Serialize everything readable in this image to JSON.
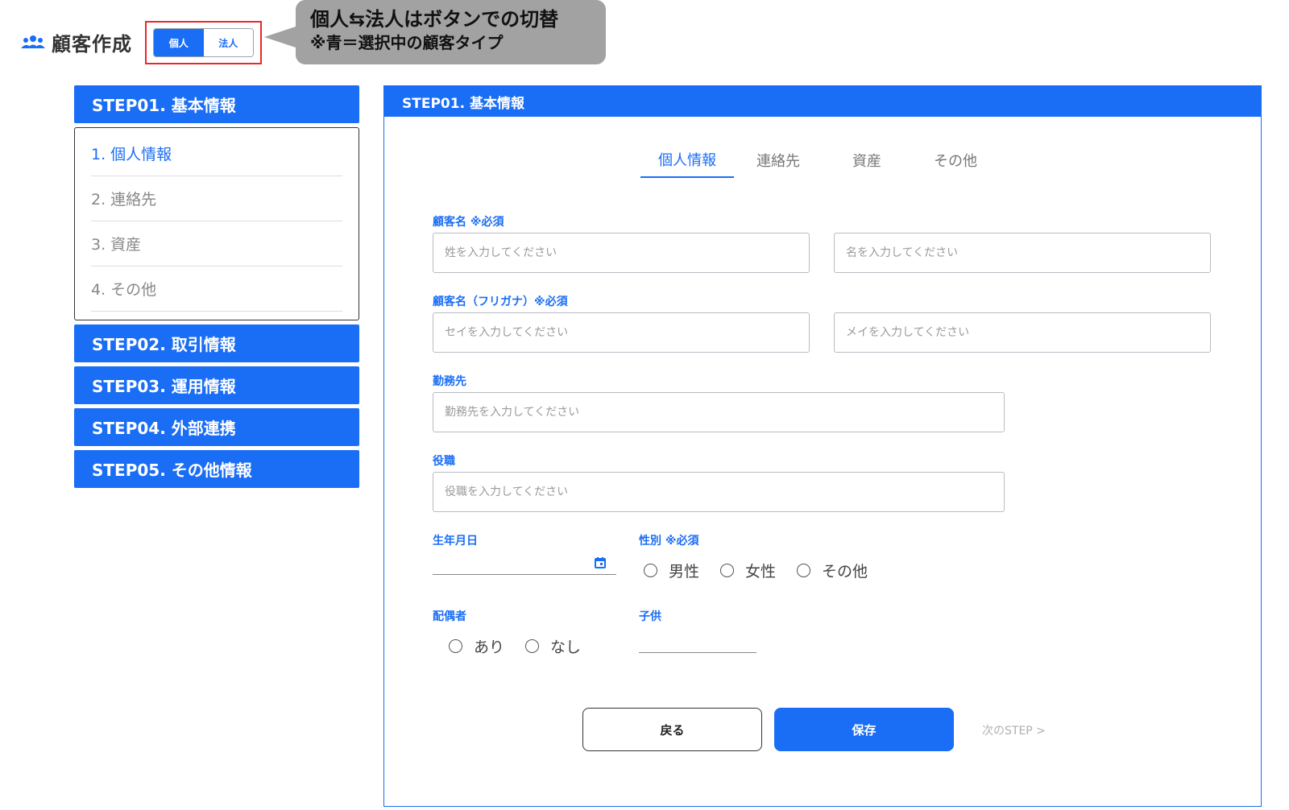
{
  "header": {
    "title": "顧客作成",
    "icon": "people-icon"
  },
  "customer_type_toggle": {
    "individual_label": "個人",
    "corporate_label": "法人",
    "selected": "個人"
  },
  "callout": {
    "line1": "個人⇆法人はボタンでの切替",
    "line2": "※青＝選択中の顧客タイプ"
  },
  "step_nav": {
    "step1": "STEP01. 基本情報",
    "step1_items": [
      "1. 個人情報",
      "2. 連絡先",
      "3. 資産",
      "4. その他"
    ],
    "step2": "STEP02. 取引情報",
    "step3": "STEP03. 運用情報",
    "step4": "STEP04. 外部連携",
    "step5": "STEP05. その他情報"
  },
  "panel": {
    "header": "STEP01. 基本情報",
    "tabs": [
      "個人情報",
      "連絡先",
      "資産",
      "その他"
    ],
    "active_tab": "個人情報"
  },
  "form": {
    "name_label": "顧客名 ※必須",
    "last_name_placeholder": "姓を入力してください",
    "first_name_placeholder": "名を入力してください",
    "kana_label": "顧客名（フリガナ）※必須",
    "last_kana_placeholder": "セイを入力してください",
    "first_kana_placeholder": "メイを入力してください",
    "employer_label": "勤務先",
    "employer_placeholder": "勤務先を入力してください",
    "position_label": "役職",
    "position_placeholder": "役職を入力してください",
    "birthdate_label": "生年月日",
    "gender_label": "性別 ※必須",
    "gender_options": [
      "男性",
      "女性",
      "その他"
    ],
    "spouse_label": "配偶者",
    "spouse_options": [
      "あり",
      "なし"
    ],
    "children_label": "子供"
  },
  "actions": {
    "back": "戻る",
    "save": "保存",
    "next": "次のSTEP >"
  },
  "colors": {
    "accent": "#1a6df5",
    "highlight_border": "#e8282b",
    "callout_bg": "#a2a2a2"
  }
}
